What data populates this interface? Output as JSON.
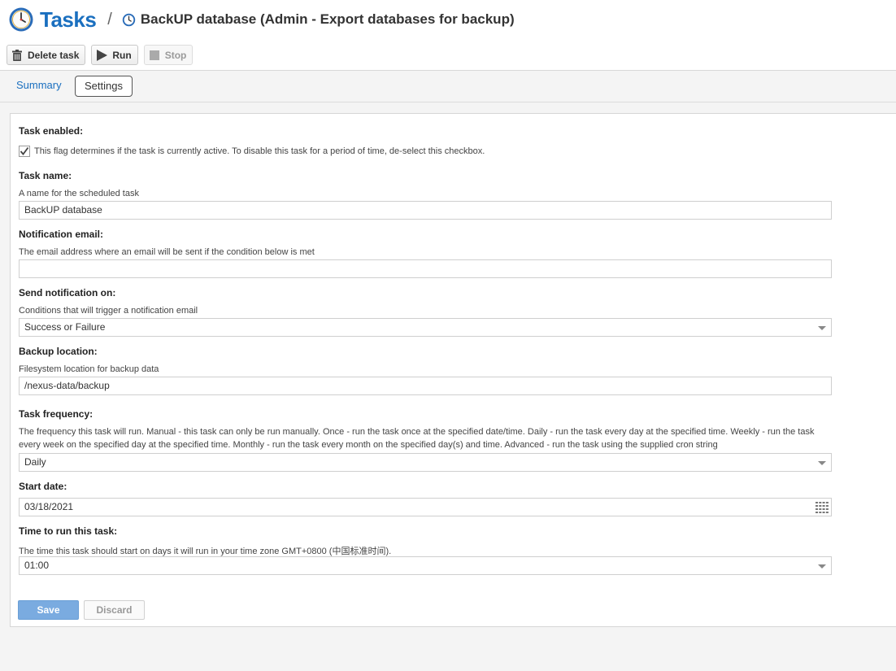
{
  "header": {
    "title": "Tasks",
    "separator": "/",
    "subtitle": "BackUP database (Admin - Export databases for backup)"
  },
  "toolbar": {
    "delete_label": "Delete task",
    "run_label": "Run",
    "stop_label": "Stop"
  },
  "tabs": {
    "summary": "Summary",
    "settings": "Settings"
  },
  "form": {
    "task_enabled": {
      "label": "Task enabled:",
      "help": "This flag determines if the task is currently active. To disable this task for a period of time, de-select this checkbox.",
      "checked": true
    },
    "task_name": {
      "label": "Task name:",
      "help": "A name for the scheduled task",
      "value": "BackUP database"
    },
    "notification_email": {
      "label": "Notification email:",
      "help": "The email address where an email will be sent if the condition below is met",
      "value": ""
    },
    "send_notification": {
      "label": "Send notification on:",
      "help": "Conditions that will trigger a notification email",
      "value": "Success or Failure"
    },
    "backup_location": {
      "label": "Backup location:",
      "help": "Filesystem location for backup data",
      "value": "/nexus-data/backup"
    },
    "task_frequency": {
      "label": "Task frequency:",
      "help": "The frequency this task will run. Manual - this task can only be run manually. Once - run the task once at the specified date/time. Daily - run the task every day at the specified time. Weekly - run the task every week on the specified day at the specified time. Monthly - run the task every month on the specified day(s) and time. Advanced - run the task using the supplied cron string",
      "value": "Daily"
    },
    "start_date": {
      "label": "Start date:",
      "value": "03/18/2021"
    },
    "time_to_run": {
      "label": "Time to run this task:",
      "help": "The time this task should start on days it will run in your time zone GMT+0800 (中国标准时间).",
      "value": "01:00"
    }
  },
  "actions": {
    "save_label": "Save",
    "discard_label": "Discard"
  },
  "colors": {
    "accent": "#1a6fbf",
    "save_button": "#7aabe0"
  }
}
